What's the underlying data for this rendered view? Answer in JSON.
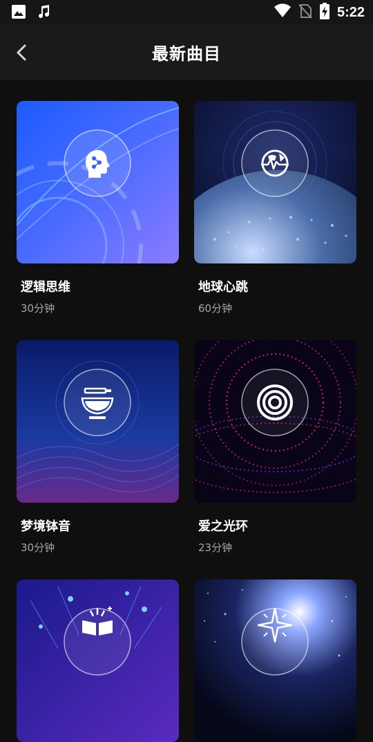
{
  "status_bar": {
    "time": "5:22",
    "left_icons": [
      "image-icon",
      "music-note-icon"
    ],
    "right_icons": [
      "wifi-icon",
      "no-sim-icon",
      "battery-charging-icon"
    ]
  },
  "toolbar": {
    "title": "最新曲目",
    "back_icon": "chevron-left-icon"
  },
  "tracks": [
    {
      "title": "逻辑思维",
      "duration": "30分钟",
      "icon": "head-network-icon"
    },
    {
      "title": "地球心跳",
      "duration": "60分钟",
      "icon": "globe-pulse-icon"
    },
    {
      "title": "梦境钵音",
      "duration": "30分钟",
      "icon": "singing-bowl-icon"
    },
    {
      "title": "爱之光环",
      "duration": "23分钟",
      "icon": "concentric-rings-icon"
    },
    {
      "title": "",
      "duration": "",
      "icon": "open-book-sparkle-icon"
    },
    {
      "title": "",
      "duration": "",
      "icon": "star-burst-icon"
    }
  ],
  "colors": {
    "background": "#0f0f0f",
    "toolbar": "#1a1a1a",
    "text_primary": "#ffffff",
    "text_secondary": "#a8a8a8"
  }
}
